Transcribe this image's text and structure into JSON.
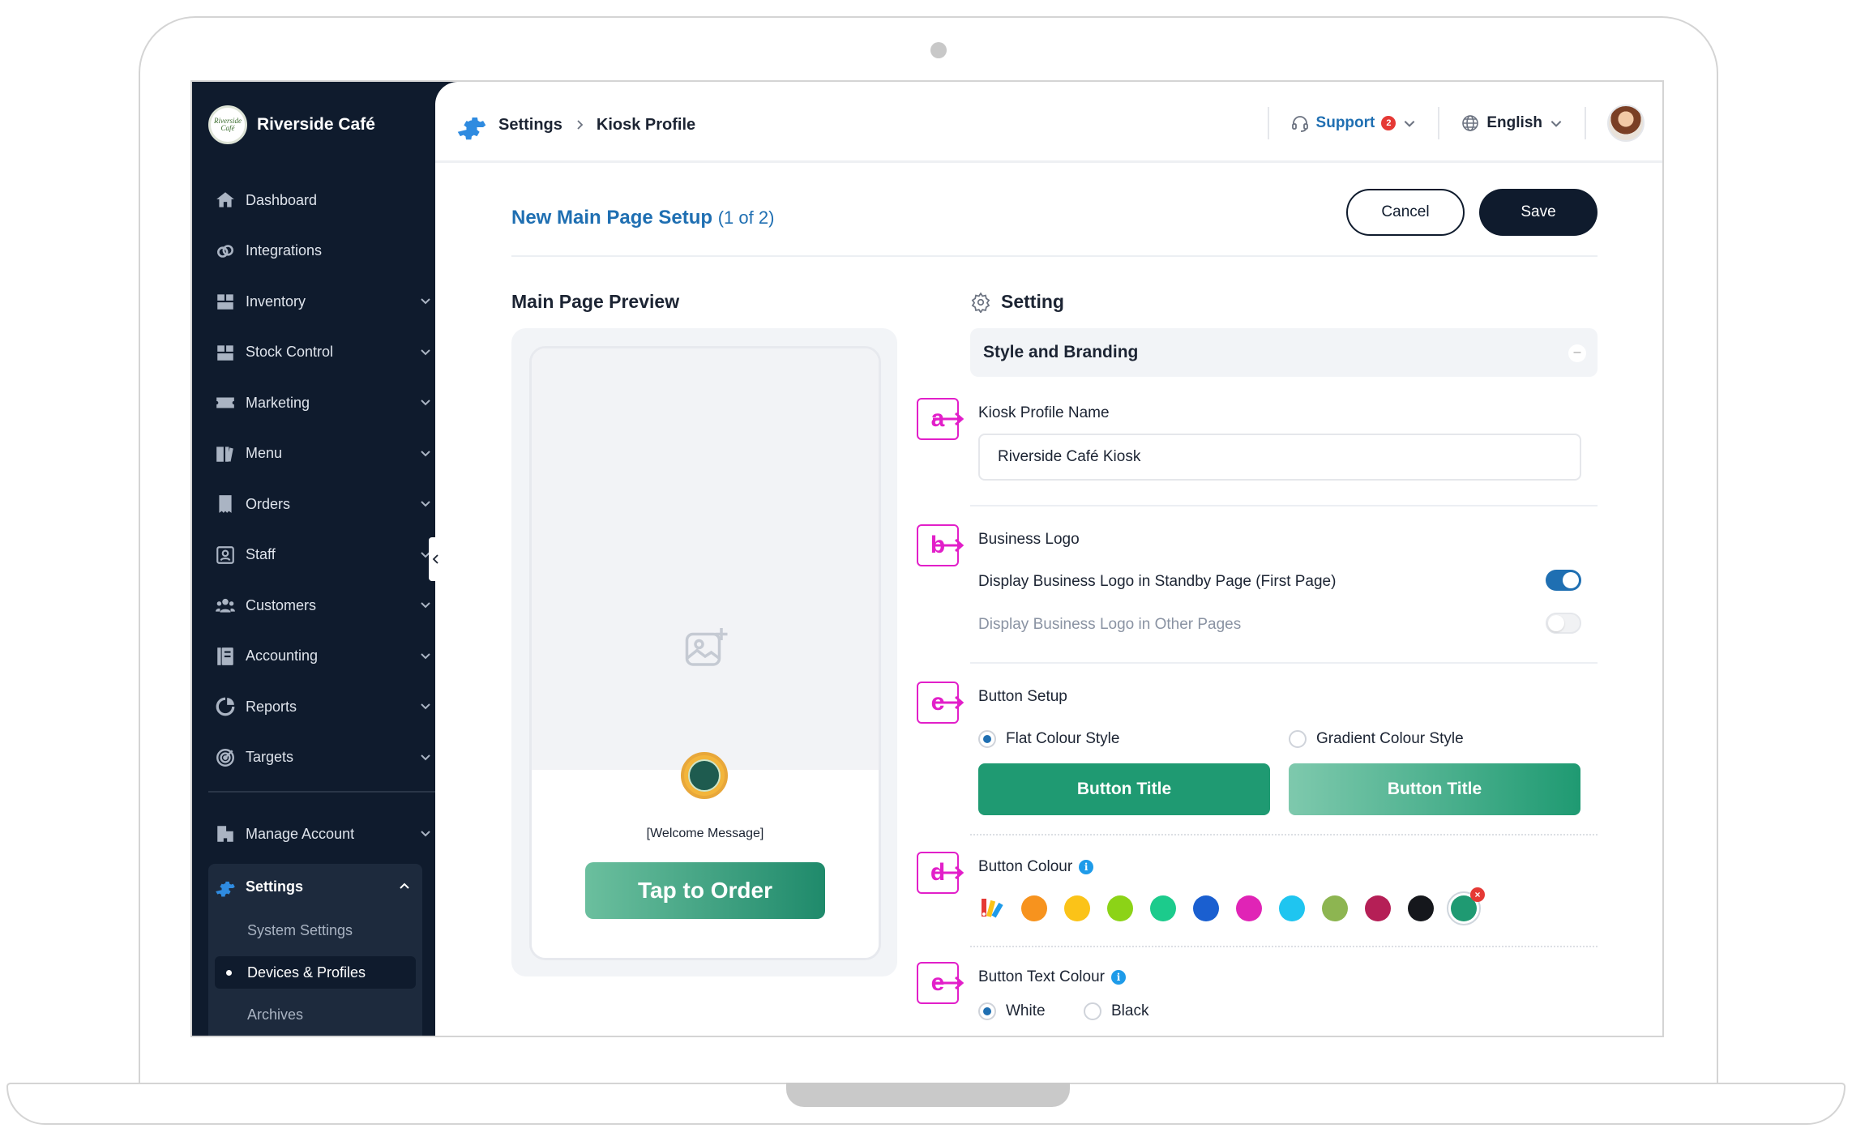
{
  "brand": {
    "name": "Riverside Café",
    "logo_text": "Riverside Café"
  },
  "sidebar": {
    "items": [
      {
        "label": "Dashboard",
        "icon": "home-icon",
        "has_chevron": false
      },
      {
        "label": "Integrations",
        "icon": "link-icon",
        "has_chevron": false
      },
      {
        "label": "Inventory",
        "icon": "boxes-icon",
        "has_chevron": true
      },
      {
        "label": "Stock Control",
        "icon": "boxes-icon",
        "has_chevron": true
      },
      {
        "label": "Marketing",
        "icon": "ticket-icon",
        "has_chevron": true
      },
      {
        "label": "Menu",
        "icon": "book-icon",
        "has_chevron": true
      },
      {
        "label": "Orders",
        "icon": "receipt-icon",
        "has_chevron": true
      },
      {
        "label": "Staff",
        "icon": "id-card-icon",
        "has_chevron": true
      },
      {
        "label": "Customers",
        "icon": "users-icon",
        "has_chevron": true
      },
      {
        "label": "Accounting",
        "icon": "ledger-icon",
        "has_chevron": true
      },
      {
        "label": "Reports",
        "icon": "pie-chart-icon",
        "has_chevron": true
      },
      {
        "label": "Targets",
        "icon": "target-icon",
        "has_chevron": true
      }
    ],
    "manage_account": "Manage Account",
    "settings": {
      "label": "Settings",
      "sub_items": [
        "System Settings",
        "Devices & Profiles",
        "Archives"
      ],
      "active": "Devices & Profiles"
    }
  },
  "topbar": {
    "breadcrumb": [
      "Settings",
      "Kiosk Profile"
    ],
    "support_label": "Support",
    "support_badge": "2",
    "language": "English"
  },
  "page": {
    "title": "New Main Page Setup",
    "step": "(1 of 2)",
    "cancel_label": "Cancel",
    "save_label": "Save"
  },
  "preview": {
    "title": "Main Page Preview",
    "welcome": "[Welcome Message]",
    "tap_button": "Tap to Order"
  },
  "settings_panel": {
    "title": "Setting",
    "section": "Style and Branding",
    "markers": [
      "a",
      "b",
      "c",
      "d",
      "e"
    ],
    "kiosk_profile_name": {
      "label": "Kiosk Profile Name",
      "value": "Riverside Café Kiosk"
    },
    "business_logo": {
      "label": "Business Logo",
      "toggles": [
        {
          "label": "Display Business Logo in Standby Page (First Page)",
          "on": true
        },
        {
          "label": "Display Business Logo in Other Pages",
          "on": false
        }
      ]
    },
    "button_setup": {
      "label": "Button Setup",
      "options": [
        {
          "label": "Flat Colour Style",
          "checked": true
        },
        {
          "label": "Gradient Colour Style",
          "checked": false
        }
      ],
      "preview_label": "Button Title"
    },
    "button_colour": {
      "label": "Button Colour",
      "swatches": [
        "#F7931E",
        "#FBC318",
        "#8CD317",
        "#1CCB8C",
        "#1A5FD0",
        "#E024B6",
        "#1FC5F0",
        "#8DB551",
        "#B51F56",
        "#15171C",
        "#1F9A72"
      ],
      "selected": "#1F9A72"
    },
    "button_text_colour": {
      "label": "Button Text Colour",
      "options": [
        {
          "label": "White",
          "checked": true
        },
        {
          "label": "Black",
          "checked": false
        }
      ]
    }
  },
  "colors": {
    "sidebar_bg": "#0F1B2D",
    "accent_blue": "#1F6FB2",
    "marker_magenta": "#E21FC9",
    "button_green": "#1F9A72"
  }
}
